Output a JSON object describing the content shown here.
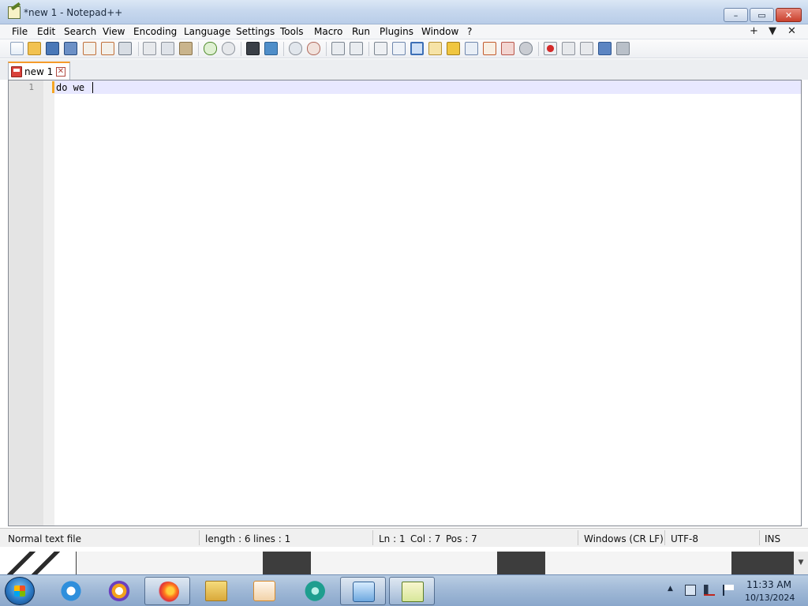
{
  "window": {
    "title": "*new 1 - Notepad++",
    "controls": {
      "minimize": "–",
      "maximize": "▭",
      "close": "✕"
    }
  },
  "menu": {
    "items": [
      "File",
      "Edit",
      "Search",
      "View",
      "Encoding",
      "Language",
      "Settings",
      "Tools",
      "Macro",
      "Run",
      "Plugins",
      "Window",
      "?"
    ],
    "right": [
      "+",
      "▼",
      "✕"
    ]
  },
  "toolbar": {
    "icons": [
      "new-file-icon",
      "open-file-icon",
      "save-icon",
      "save-all-icon",
      "close-icon",
      "close-all-icon",
      "print-icon",
      "cut-icon",
      "copy-icon",
      "paste-icon",
      "undo-icon",
      "redo-icon",
      "find-icon",
      "replace-icon",
      "zoom-in-icon",
      "zoom-out-icon",
      "sync-v-icon",
      "sync-h-icon",
      "word-wrap-icon",
      "show-all-chars-icon",
      "indent-guide-icon",
      "udl-icon",
      "doc-map-icon",
      "doc-list-icon",
      "function-list-icon",
      "folder-workspace-icon",
      "monitoring-icon",
      "record-macro-icon",
      "stop-record-icon",
      "playback-icon",
      "run-macro-multiple-icon",
      "save-macro-icon"
    ]
  },
  "tabs": [
    {
      "label": "new 1",
      "close": "✕"
    }
  ],
  "editor": {
    "line_number": "1",
    "content": "do we "
  },
  "status": {
    "file_type": "Normal text file",
    "length": "length : 6",
    "lines": "lines : 1",
    "ln": "Ln : 1",
    "col": "Col : 7",
    "pos": "Pos : 7",
    "eol": "Windows (CR LF)",
    "encoding": "UTF-8",
    "mode": "INS"
  },
  "taskbar": {
    "apps": [
      "internet-explorer-icon",
      "privacy-browser-icon",
      "firefox-icon",
      "file-explorer-icon",
      "media-player-icon",
      "chat-app-icon",
      "control-panel-icon",
      "notepadpp-icon"
    ],
    "clock_time": "11:33 AM",
    "clock_date": "10/13/2024",
    "tray_arrow": "▲"
  }
}
